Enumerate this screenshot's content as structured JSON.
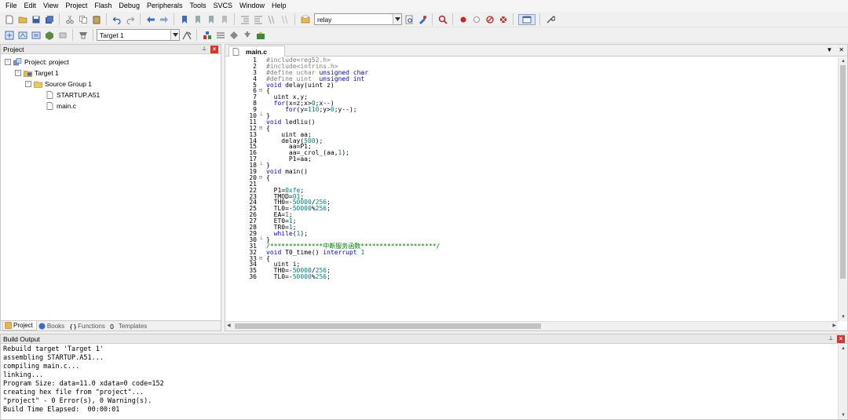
{
  "menu": [
    "File",
    "Edit",
    "View",
    "Project",
    "Flash",
    "Debug",
    "Peripherals",
    "Tools",
    "SVCS",
    "Window",
    "Help"
  ],
  "toolbar1": {
    "find_combo_value": "relay"
  },
  "toolbar2": {
    "target_combo_value": "Target 1"
  },
  "project_panel": {
    "title": "Project",
    "tree": [
      {
        "label": "Project: project",
        "level": 0,
        "icon": "project-icon",
        "expander": "-"
      },
      {
        "label": "Target 1",
        "level": 1,
        "icon": "target-icon",
        "expander": "-"
      },
      {
        "label": "Source Group 1",
        "level": 2,
        "icon": "folder-icon",
        "expander": "-"
      },
      {
        "label": "STARTUP.A51",
        "level": 3,
        "icon": "file-icon",
        "expander": ""
      },
      {
        "label": "main.c",
        "level": 3,
        "icon": "file-icon",
        "expander": ""
      }
    ],
    "tabs": [
      {
        "label": "Project",
        "icon": "project-tab-icon",
        "active": true
      },
      {
        "label": "Books",
        "icon": "books-icon",
        "active": false
      },
      {
        "label": "Functions",
        "icon": "functions-icon",
        "active": false
      },
      {
        "label": "Templates",
        "icon": "templates-icon",
        "active": false
      }
    ]
  },
  "editor": {
    "tab_label": "main.c",
    "lines": [
      {
        "n": "1",
        "fold": "",
        "segs": [
          [
            "pp",
            "#include<reg52.h>"
          ]
        ]
      },
      {
        "n": "2",
        "fold": "",
        "segs": [
          [
            "pp",
            "#include<intrins.h>"
          ]
        ]
      },
      {
        "n": "3",
        "fold": "",
        "segs": [
          [
            "pp",
            "#define uchar "
          ],
          [
            "kw",
            "unsigned char"
          ]
        ]
      },
      {
        "n": "4",
        "fold": "",
        "segs": [
          [
            "pp",
            "#define uint  "
          ],
          [
            "kw",
            "unsigned int"
          ]
        ]
      },
      {
        "n": "5",
        "fold": "",
        "segs": [
          [
            "kw",
            "void"
          ],
          [
            "",
            " delay(uint z)"
          ]
        ]
      },
      {
        "n": "6",
        "fold": "⊟",
        "segs": [
          [
            "",
            "{"
          ]
        ]
      },
      {
        "n": "7",
        "fold": "",
        "segs": [
          [
            "",
            "  uint x,y;"
          ]
        ]
      },
      {
        "n": "8",
        "fold": "",
        "segs": [
          [
            "kw",
            "  for"
          ],
          [
            "",
            "(x=z;x>"
          ],
          [
            "num",
            "0"
          ],
          [
            "",
            ";x--)"
          ]
        ]
      },
      {
        "n": "9",
        "fold": "",
        "segs": [
          [
            "kw",
            "     for"
          ],
          [
            "",
            "(y="
          ],
          [
            "num",
            "110"
          ],
          [
            "",
            ";y>"
          ],
          [
            "num",
            "0"
          ],
          [
            "",
            ";y--);"
          ]
        ]
      },
      {
        "n": "10",
        "fold": "└",
        "segs": [
          [
            "",
            "}"
          ]
        ]
      },
      {
        "n": "11",
        "fold": "",
        "segs": [
          [
            "kw",
            "void"
          ],
          [
            "",
            " ledliu()"
          ]
        ]
      },
      {
        "n": "12",
        "fold": "⊟",
        "segs": [
          [
            "",
            "{"
          ]
        ]
      },
      {
        "n": "13",
        "fold": "",
        "segs": [
          [
            "",
            "    uint aa;"
          ]
        ]
      },
      {
        "n": "14",
        "fold": "",
        "segs": [
          [
            "",
            "    delay("
          ],
          [
            "num",
            "500"
          ],
          [
            "",
            ");"
          ]
        ]
      },
      {
        "n": "15",
        "fold": "",
        "segs": [
          [
            "",
            "      aa=P1;"
          ]
        ]
      },
      {
        "n": "16",
        "fold": "",
        "segs": [
          [
            "",
            "      aa=_crol_(aa,"
          ],
          [
            "num",
            "1"
          ],
          [
            "",
            ");"
          ]
        ]
      },
      {
        "n": "17",
        "fold": "",
        "segs": [
          [
            "",
            "      P1=aa;"
          ]
        ]
      },
      {
        "n": "18",
        "fold": "└",
        "segs": [
          [
            "",
            "}"
          ]
        ]
      },
      {
        "n": "19",
        "fold": "",
        "segs": [
          [
            "kw",
            "void"
          ],
          [
            "",
            " main()"
          ]
        ]
      },
      {
        "n": "20",
        "fold": "⊟",
        "segs": [
          [
            "",
            "{"
          ]
        ]
      },
      {
        "n": "21",
        "fold": "",
        "segs": [
          [
            "",
            ""
          ]
        ]
      },
      {
        "n": "22",
        "fold": "",
        "segs": [
          [
            "",
            "  P1="
          ],
          [
            "num",
            "0xfe"
          ],
          [
            "",
            ";"
          ]
        ]
      },
      {
        "n": "23",
        "fold": "",
        "segs": [
          [
            "",
            "  TMOD="
          ],
          [
            "num",
            "01"
          ],
          [
            "",
            ";"
          ]
        ]
      },
      {
        "n": "24",
        "fold": "",
        "segs": [
          [
            "",
            "  TH0=-"
          ],
          [
            "num",
            "50000"
          ],
          [
            "",
            "/"
          ],
          [
            "num",
            "256"
          ],
          [
            "",
            ";"
          ]
        ]
      },
      {
        "n": "25",
        "fold": "",
        "segs": [
          [
            "",
            "  TL0=-"
          ],
          [
            "num",
            "50000"
          ],
          [
            "",
            "%"
          ],
          [
            "num",
            "256"
          ],
          [
            "",
            ";"
          ]
        ]
      },
      {
        "n": "26",
        "fold": "",
        "segs": [
          [
            "",
            "  EA="
          ],
          [
            "num",
            "1"
          ],
          [
            "",
            ";"
          ]
        ]
      },
      {
        "n": "27",
        "fold": "",
        "segs": [
          [
            "",
            "  ET0="
          ],
          [
            "num",
            "1"
          ],
          [
            "",
            ";"
          ]
        ]
      },
      {
        "n": "28",
        "fold": "",
        "segs": [
          [
            "",
            "  TR0="
          ],
          [
            "num",
            "1"
          ],
          [
            "",
            ";"
          ]
        ]
      },
      {
        "n": "29",
        "fold": "",
        "segs": [
          [
            "kw",
            "  while"
          ],
          [
            "",
            "("
          ],
          [
            "num",
            "1"
          ],
          [
            "",
            ");"
          ]
        ]
      },
      {
        "n": "30",
        "fold": "└",
        "segs": [
          [
            "",
            "}"
          ]
        ]
      },
      {
        "n": "31",
        "fold": "",
        "segs": [
          [
            "cmt",
            "/**************中断服务函数********************/"
          ]
        ]
      },
      {
        "n": "32",
        "fold": "",
        "segs": [
          [
            "kw",
            "void"
          ],
          [
            "",
            " T0_time() "
          ],
          [
            "kw",
            "interrupt"
          ],
          [
            "",
            " "
          ],
          [
            "num",
            "1"
          ]
        ]
      },
      {
        "n": "33",
        "fold": "⊟",
        "segs": [
          [
            "",
            "{"
          ]
        ]
      },
      {
        "n": "34",
        "fold": "",
        "segs": [
          [
            "",
            "  uint i;"
          ]
        ]
      },
      {
        "n": "35",
        "fold": "",
        "segs": [
          [
            "",
            "  TH0=-"
          ],
          [
            "num",
            "50000"
          ],
          [
            "",
            "/"
          ],
          [
            "num",
            "256"
          ],
          [
            "",
            ";"
          ]
        ]
      },
      {
        "n": "36",
        "fold": "",
        "segs": [
          [
            "",
            "  TL0=-"
          ],
          [
            "num",
            "50000"
          ],
          [
            "",
            "%"
          ],
          [
            "num",
            "256"
          ],
          [
            "",
            ";"
          ]
        ]
      }
    ]
  },
  "build_output": {
    "title": "Build Output",
    "lines": [
      "Rebuild target 'Target 1'",
      "assembling STARTUP.A51...",
      "compiling main.c...",
      "linking...",
      "Program Size: data=11.0 xdata=0 code=152",
      "creating hex file from \"project\"...",
      "\"project\" - 0 Error(s), 0 Warning(s).",
      "Build Time Elapsed:  00:00:01"
    ]
  },
  "colors": {
    "keyword": "#0000ff",
    "preprocessor": "#808080",
    "number": "#008080",
    "comment": "#008000",
    "close_button": "#d9342b"
  }
}
